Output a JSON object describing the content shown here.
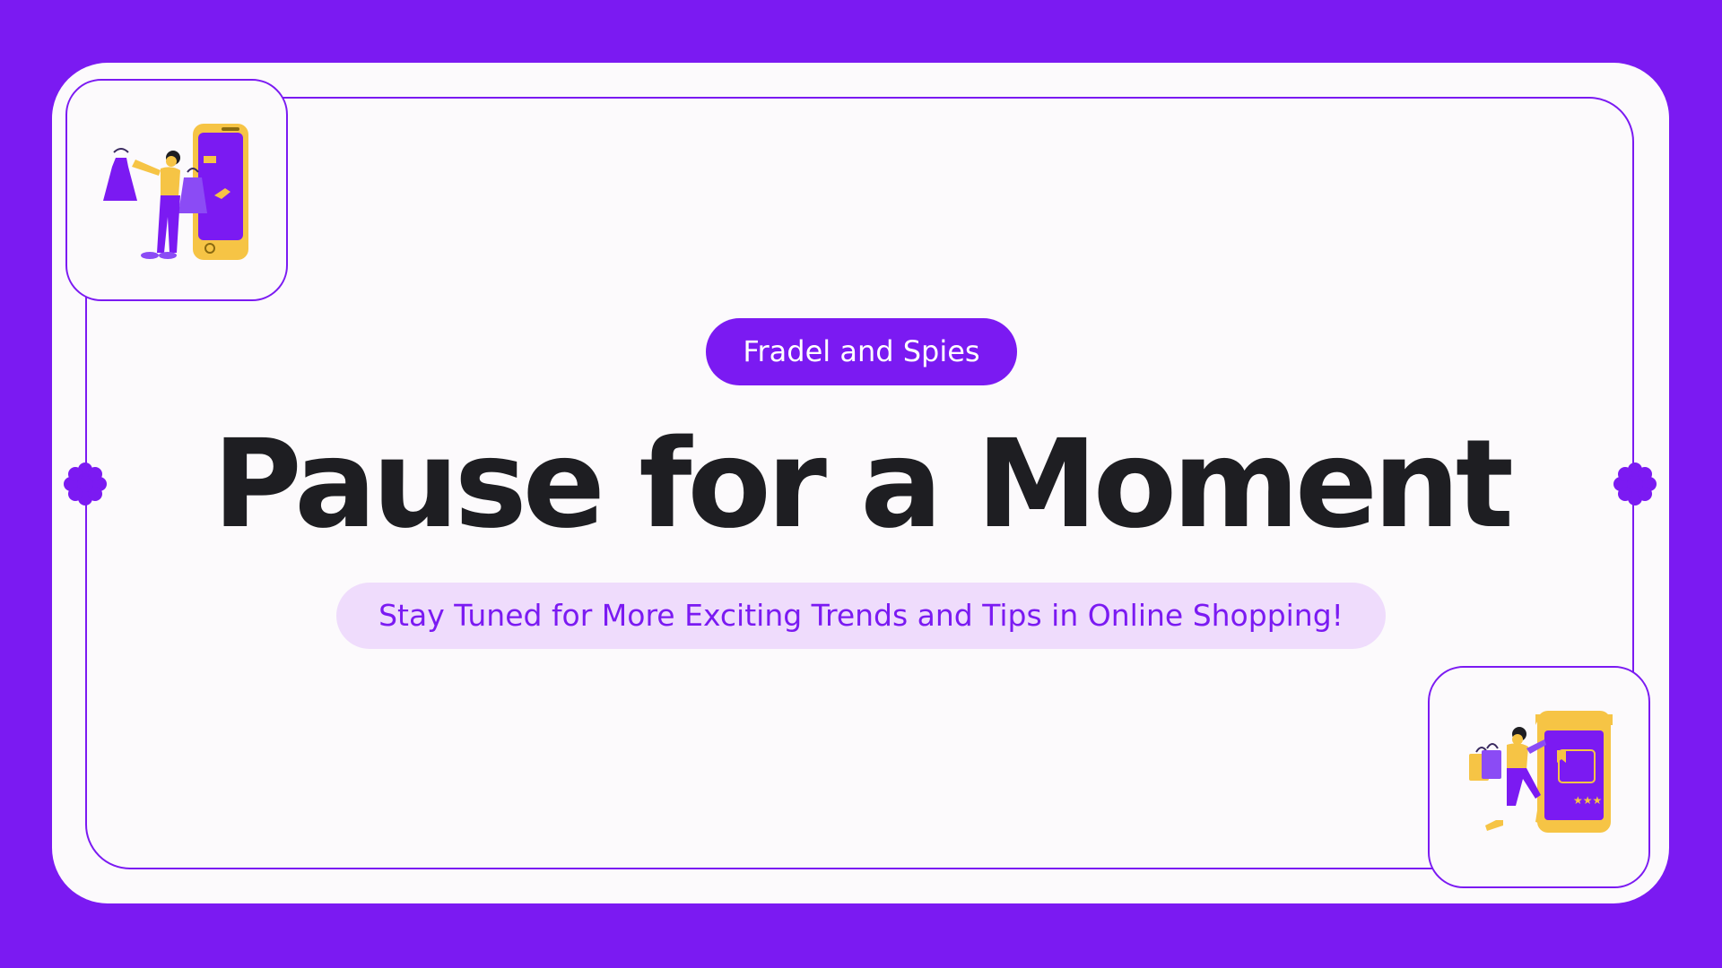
{
  "brand": {
    "label": "Fradel and Spies"
  },
  "headline": {
    "text": "Pause for a Moment"
  },
  "subtitle": {
    "text": "Stay Tuned for More Exciting Trends and Tips in Online Shopping!"
  },
  "colors": {
    "background": "#7b1af2",
    "card": "#fcfafc",
    "accent": "#7b1af2",
    "headline": "#1e1e22",
    "subtitle_bg": "#efdcfc",
    "illustration_yellow": "#f6c445"
  },
  "illustrations": {
    "top_left": "woman-shopping-on-phone-illustration",
    "bottom_right": "man-with-bags-phone-store-illustration"
  },
  "decorations": [
    "flower-dot-left",
    "flower-dot-right"
  ]
}
